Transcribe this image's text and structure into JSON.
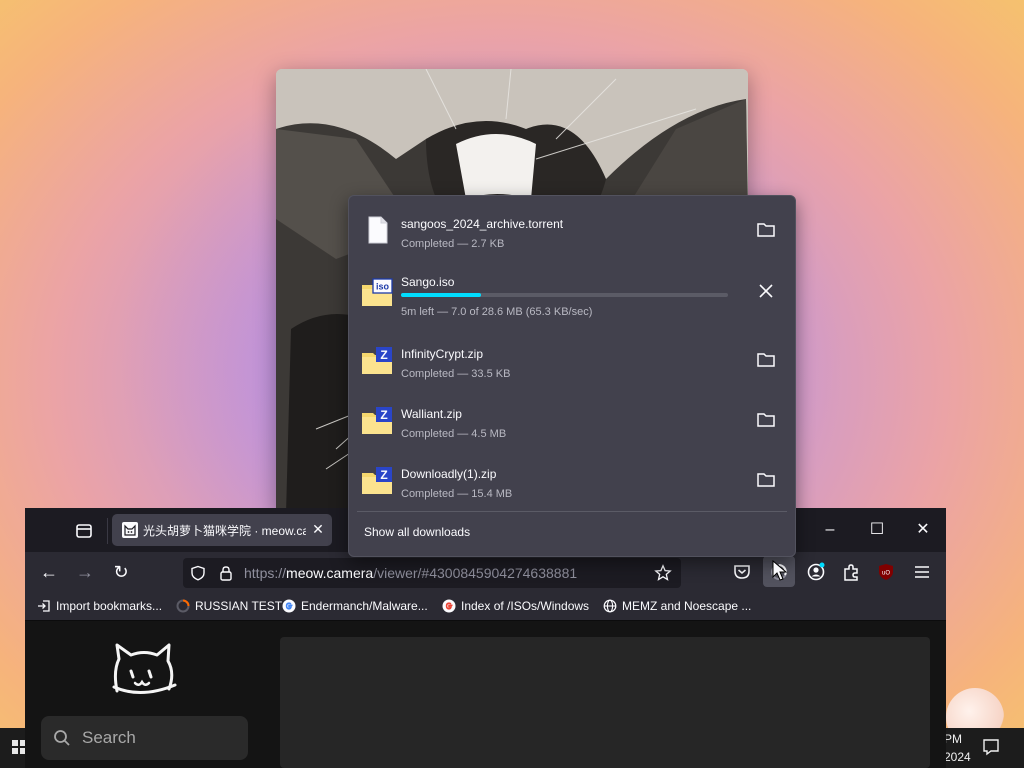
{
  "browser": {
    "tab": {
      "title": "光头胡萝卜猫咪学院 · meow.camera",
      "favicon": "cat-face-icon"
    },
    "url": {
      "scheme": "https://",
      "host": "meow.camera",
      "path": "/viewer/#4300845904274638881"
    },
    "bookmarks": [
      {
        "label": "Import bookmarks...",
        "icon": "import-icon"
      },
      {
        "label": "RUSSIAN TEST",
        "icon": "loading-icon"
      },
      {
        "label": "Endermanch/Malware...",
        "icon": "google-icon"
      },
      {
        "label": "Index of /ISOs/Windows",
        "icon": "google-icon"
      },
      {
        "label": "MEMZ and Noescape ...",
        "icon": "globe-icon"
      }
    ]
  },
  "downloads": {
    "items": [
      {
        "name": "sangoos_2024_archive.torrent",
        "status": "Completed — 2.7 KB",
        "icon": "blank-file-icon",
        "action": "open-folder"
      },
      {
        "name": "Sango.iso",
        "status": "5m left — 7.0 of 28.6 MB (65.3 KB/sec)",
        "icon": "iso-folder-icon",
        "action": "cancel",
        "progress": 0.245,
        "icon_badge": "iso"
      },
      {
        "name": "InfinityCrypt.zip",
        "status": "Completed — 33.5 KB",
        "icon": "zip-folder-icon",
        "action": "open-folder",
        "icon_badge": "Z"
      },
      {
        "name": "Walliant.zip",
        "status": "Completed — 4.5 MB",
        "icon": "zip-folder-icon",
        "action": "open-folder",
        "icon_badge": "Z"
      },
      {
        "name": "Downloadly(1).zip",
        "status": "Completed — 15.4 MB",
        "icon": "zip-folder-icon",
        "action": "open-folder",
        "icon_badge": "Z"
      }
    ],
    "show_all_label": "Show all downloads"
  },
  "page": {
    "search_placeholder": "Search"
  },
  "taskbar": {
    "time_partial": "PM",
    "date_partial": "2024"
  },
  "colors": {
    "progress": "#00ddff",
    "panel_bg": "#42414d",
    "browser_bg": "#1c1b22",
    "toolbar_bg": "#2b2a33"
  }
}
